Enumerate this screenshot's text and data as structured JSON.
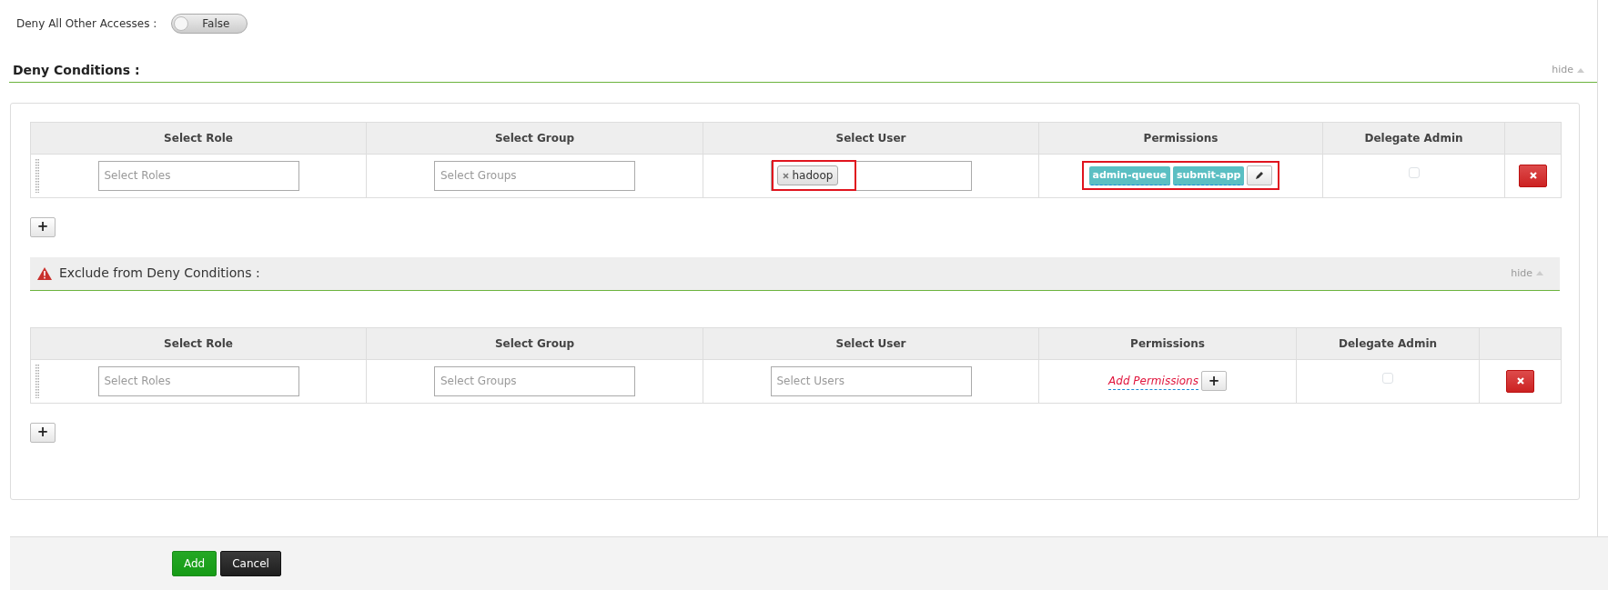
{
  "deny_all_other_accesses": {
    "label": "Deny All Other Accesses :",
    "on": false,
    "value": "False"
  },
  "deny_conditions": {
    "title": "Deny Conditions :",
    "hide_link": "hide"
  },
  "condition_tables": [
    {
      "columns": [
        {
          "label": "Select Role"
        },
        {
          "label": "Select Group"
        },
        {
          "label": "Select User"
        },
        {
          "label": "Permissions"
        },
        {
          "label": "Delegate Admin"
        },
        {}
      ],
      "rows": [
        {
          "role": {
            "placeholder": "Select Roles"
          },
          "group": {
            "placeholder": "Select Groups"
          },
          "user": {
            "tags": [
              "hadoop"
            ],
            "highlighted": true
          },
          "permissions": {
            "tags": [
              "admin-queue",
              "submit-app"
            ],
            "highlighted": true
          },
          "delegate_admin": false
        }
      ],
      "add_row_button": "+"
    },
    {
      "section_title": "Exclude from Deny Conditions :",
      "hide_link": "hide",
      "columns": [
        {
          "label": "Select Role"
        },
        {
          "label": "Select Group"
        },
        {
          "label": "Select User"
        },
        {
          "label": "Permissions"
        },
        {
          "label": "Delegate Admin"
        },
        {}
      ],
      "rows": [
        {
          "role": {
            "placeholder": "Select Roles"
          },
          "group": {
            "placeholder": "Select Groups"
          },
          "user": {
            "placeholder": "Select Users"
          },
          "permissions": {
            "add_link": "Add Permissions",
            "add_button": "+"
          },
          "delegate_admin": false
        }
      ],
      "add_row_button": "+"
    }
  ],
  "buttons": {
    "add": "Add",
    "cancel": "Cancel"
  }
}
